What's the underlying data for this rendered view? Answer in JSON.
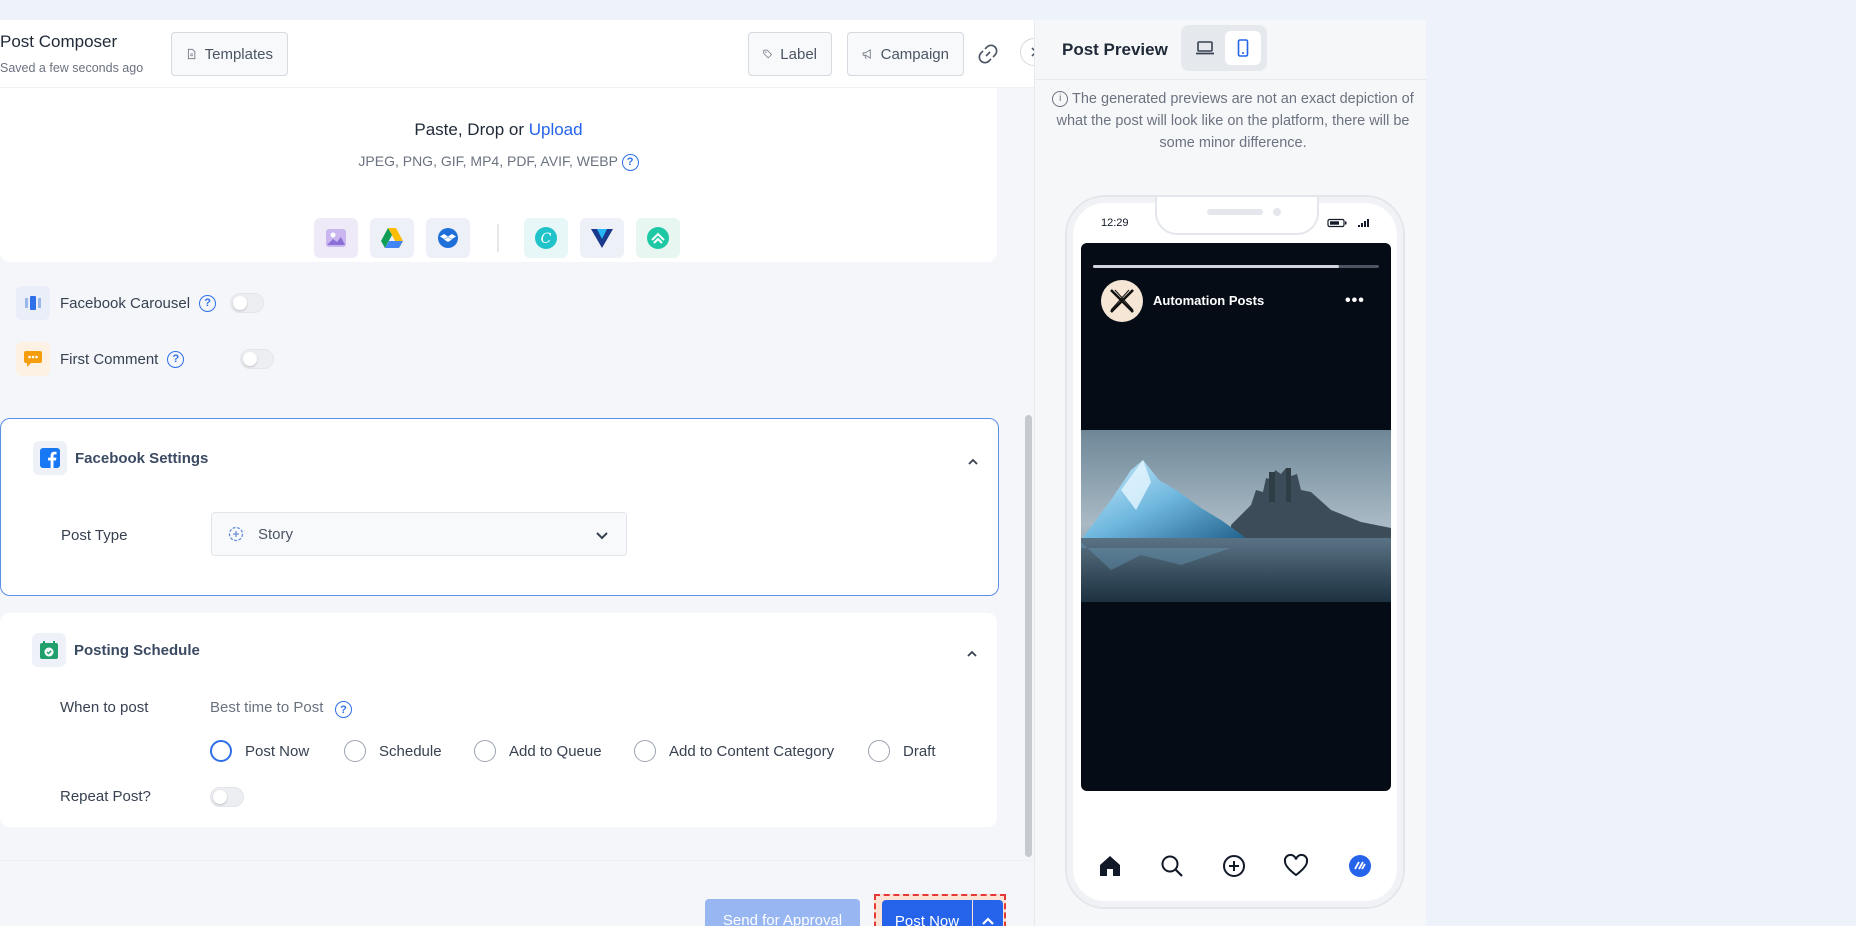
{
  "composer": {
    "title": "Post Composer",
    "saved_status": "Saved a few seconds ago",
    "templates_label": "Templates",
    "label_label": "Label",
    "campaign_label": "Campaign"
  },
  "upload": {
    "title_prefix": "Paste, Drop or ",
    "upload_link": "Upload",
    "formats": "JPEG, PNG, GIF, MP4, PDF, AVIF, WEBP",
    "sources": [
      "media-library-icon",
      "google-drive-icon",
      "dropbox-icon",
      "canva-icon",
      "vista-create-icon",
      "postnitro-icon"
    ]
  },
  "options": {
    "carousel_label": "Facebook Carousel",
    "first_comment_label": "First Comment"
  },
  "facebook_settings": {
    "title": "Facebook Settings",
    "post_type_label": "Post Type",
    "post_type_value": "Story"
  },
  "schedule": {
    "title": "Posting Schedule",
    "when_label": "When to post",
    "best_time": "Best time to Post",
    "options": [
      "Post Now",
      "Schedule",
      "Add to Queue",
      "Add to Content Category",
      "Draft"
    ],
    "selected": "Post Now",
    "repeat_label": "Repeat Post?"
  },
  "footer": {
    "approval_label": "Send for Approval",
    "post_now_label": "Post Now"
  },
  "preview": {
    "title": "Post Preview",
    "note": "The generated previews are not an exact depiction of what the post will look like on the platform, there will be some minor difference.",
    "phone_time": "12:29",
    "account_name": "Automation Posts",
    "story_progress": 0.86
  },
  "colors": {
    "accent": "#2563eb",
    "focus_border": "#5b8fe6",
    "highlight_dash": "#e53935"
  }
}
